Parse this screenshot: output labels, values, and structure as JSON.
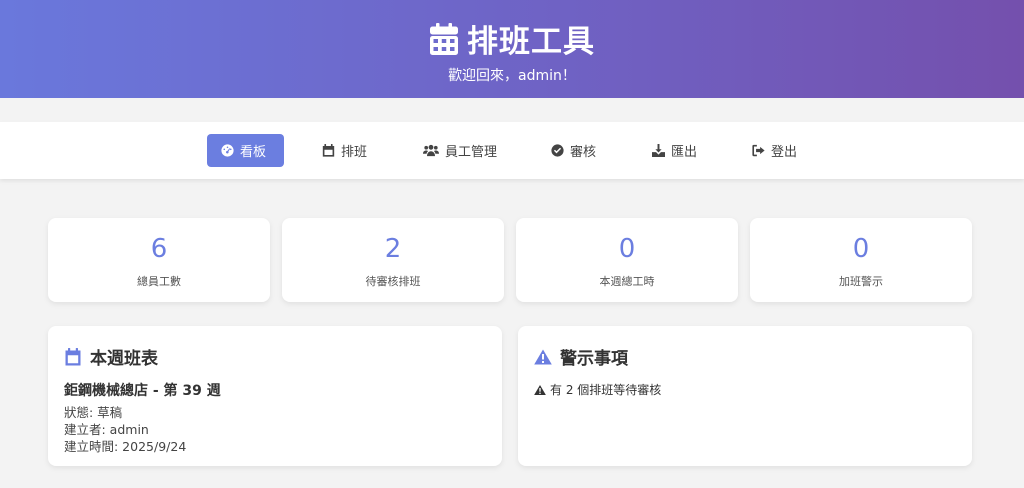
{
  "header": {
    "title": "排班工具",
    "welcome": "歡迎回來，admin！",
    "icon": "calendar-icon"
  },
  "nav": {
    "items": [
      {
        "label": "看板",
        "icon": "dashboard-gauge-icon",
        "active": true
      },
      {
        "label": "排班",
        "icon": "calendar-icon",
        "active": false
      },
      {
        "label": "員工管理",
        "icon": "users-icon",
        "active": false
      },
      {
        "label": "審核",
        "icon": "check-circle-icon",
        "active": false
      },
      {
        "label": "匯出",
        "icon": "download-icon",
        "active": false
      },
      {
        "label": "登出",
        "icon": "sign-out-icon",
        "active": false
      }
    ]
  },
  "stats": [
    {
      "value": "6",
      "label": "總員工數"
    },
    {
      "value": "2",
      "label": "待審核排班"
    },
    {
      "value": "0",
      "label": "本週總工時"
    },
    {
      "value": "0",
      "label": "加班警示"
    }
  ],
  "week_schedule": {
    "title": "本週班表",
    "icon": "calendar-icon",
    "name": "鉅鋼機械總店 - 第 39 週",
    "status": "狀態: 草稿",
    "creator": "建立者: admin",
    "created_at": "建立時間: 2025/9/24"
  },
  "alerts": {
    "title": "警示事項",
    "icon": "warning-triangle-icon",
    "items": [
      {
        "icon": "warning-triangle-icon",
        "text": "有 2 個排班等待審核"
      }
    ]
  },
  "colors": {
    "accent": "#6b7ee0",
    "header_gradient_start": "#6a78dc",
    "header_gradient_end": "#7450ad",
    "background": "#f3f3f3"
  }
}
